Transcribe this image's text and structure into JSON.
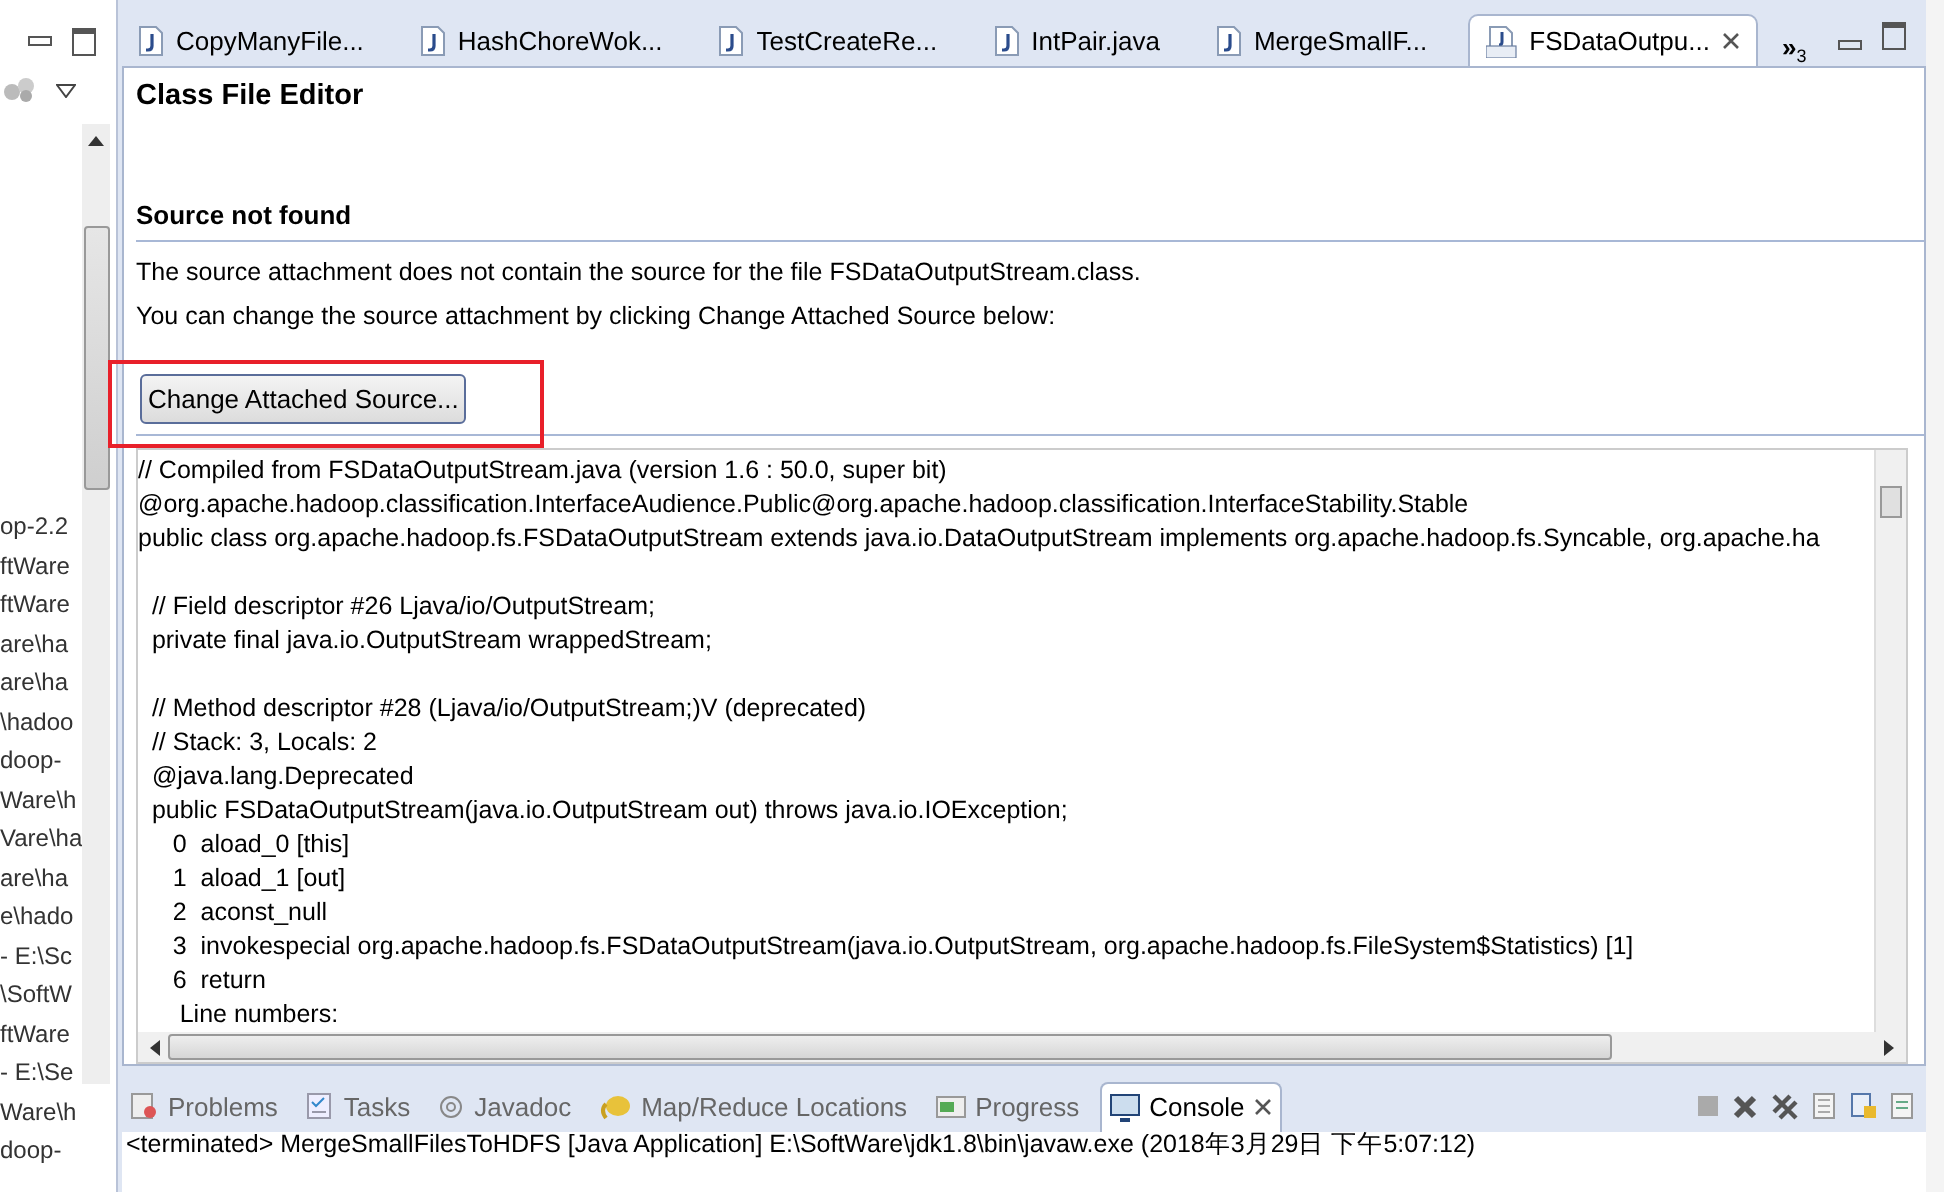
{
  "side_panel": {
    "fragments": [
      "op-2.2",
      "ftWare",
      "ftWare",
      "are\\ha",
      "are\\ha",
      "\\hadoo",
      "doop-",
      "Ware\\h",
      "Vare\\ha",
      "are\\ha",
      "e\\hado",
      "- E:\\Sc",
      "\\SoftW",
      "ftWare",
      "- E:\\Se",
      "Ware\\h",
      "doop-"
    ]
  },
  "editor_tabs": [
    {
      "label": "CopyManyFile...",
      "kind": "java",
      "selected": false
    },
    {
      "label": "HashChoreWok...",
      "kind": "java",
      "selected": false
    },
    {
      "label": "TestCreateRe...",
      "kind": "java",
      "selected": false
    },
    {
      "label": "IntPair.java",
      "kind": "java",
      "selected": false
    },
    {
      "label": "MergeSmallF...",
      "kind": "java",
      "selected": false
    },
    {
      "label": "FSDataOutpu...",
      "kind": "class",
      "selected": true
    }
  ],
  "overflow": {
    "chevron": "»",
    "count": "3"
  },
  "editor": {
    "title": "Class File Editor",
    "section_title": "Source not found",
    "messages": [
      "The source attachment does not contain the source for the file FSDataOutputStream.class.",
      "You can change the source attachment by clicking Change Attached Source below:"
    ],
    "button": "Change Attached Source...",
    "code_blocks": [
      [
        "// Compiled from FSDataOutputStream.java (version 1.6 : 50.0, super bit)",
        "@org.apache.hadoop.classification.InterfaceAudience.Public@org.apache.hadoop.classification.InterfaceStability.Stable",
        "public class org.apache.hadoop.fs.FSDataOutputStream extends java.io.DataOutputStream implements org.apache.hadoop.fs.Syncable, org.apache.ha"
      ],
      [
        "  // Field descriptor #26 Ljava/io/OutputStream;",
        "  private final java.io.OutputStream wrappedStream;"
      ],
      [
        "  // Method descriptor #28 (Ljava/io/OutputStream;)V (deprecated)",
        "  // Stack: 3, Locals: 2",
        "  @java.lang.Deprecated",
        "  public FSDataOutputStream(java.io.OutputStream out) throws java.io.IOException;",
        "     0  aload_0 [this]",
        "     1  aload_1 [out]",
        "     2  aconst_null",
        "     3  invokespecial org.apache.hadoop.fs.FSDataOutputStream(java.io.OutputStream, org.apache.hadoop.fs.FileSystem$Statistics) [1]",
        "     6  return",
        "      Line numbers:"
      ]
    ]
  },
  "bottom_tabs": [
    {
      "label": "Problems",
      "kind": "problems",
      "selected": false
    },
    {
      "label": "Tasks",
      "kind": "tasks",
      "selected": false
    },
    {
      "label": "Javadoc",
      "kind": "javadoc",
      "selected": false
    },
    {
      "label": "Map/Reduce Locations",
      "kind": "mapreduce",
      "selected": false
    },
    {
      "label": "Progress",
      "kind": "progress",
      "selected": false
    },
    {
      "label": "Console",
      "kind": "console",
      "selected": true
    }
  ],
  "console_line": "<terminated> MergeSmallFilesToHDFS [Java Application] E:\\SoftWare\\jdk1.8\\bin\\javaw.exe (2018年3月29日 下午5:07:12)"
}
